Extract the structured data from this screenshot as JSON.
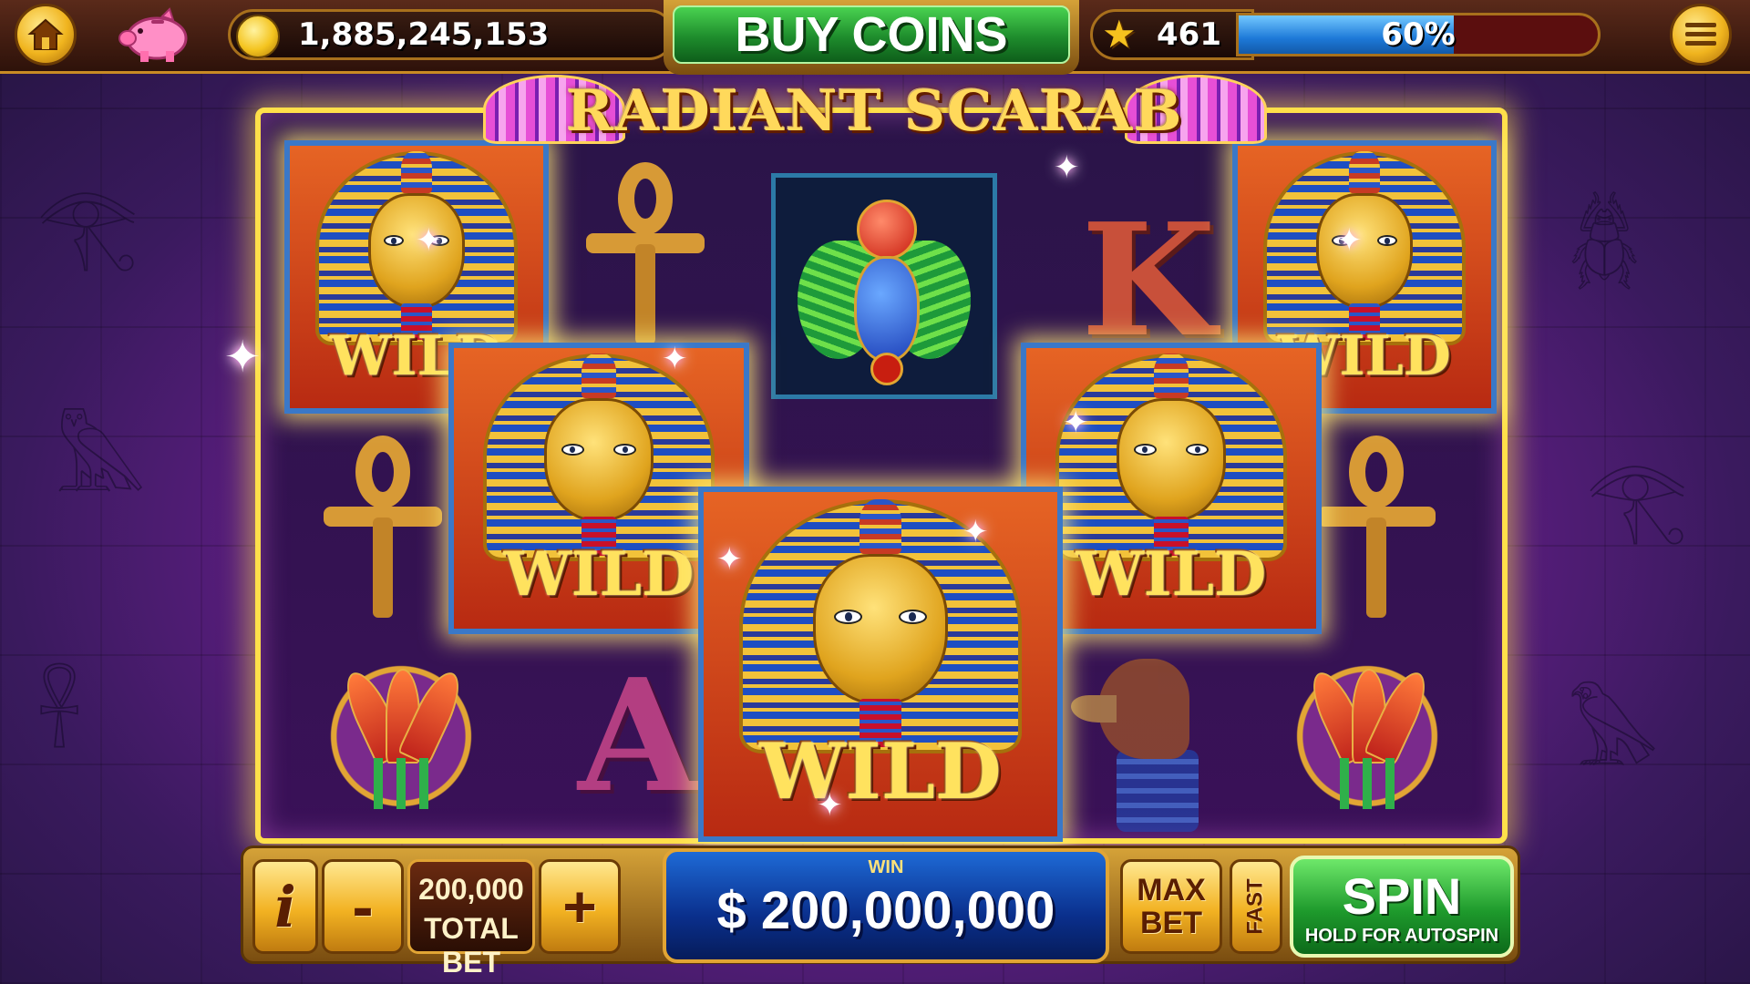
{
  "game": {
    "title": "RADIANT SCARAB"
  },
  "topbar": {
    "home_icon": "home-icon",
    "piggy_bank_icon": "piggy-bank-icon",
    "coin_balance": "1,885,245,153",
    "buy_coins_label": "BUY COINS",
    "level": "461",
    "level_progress_fraction": 0.6,
    "level_progress_label": "60%",
    "menu_icon": "menu-icon"
  },
  "reels": {
    "wild_label": "WILD",
    "symbols": {
      "king_letter": "K",
      "ace_letter": "A"
    }
  },
  "bottombar": {
    "info_label": "i",
    "decrease_bet_label": "-",
    "total_bet_value": "200,000",
    "total_bet_label": "TOTAL BET",
    "increase_bet_label": "+",
    "win_label": "WIN",
    "win_amount": "$ 200,000,000",
    "max_bet_line1": "MAX",
    "max_bet_line2": "BET",
    "fast_label": "FAST",
    "spin_label": "SPIN",
    "spin_sublabel": "HOLD FOR AUTOSPIN"
  },
  "colors": {
    "background": "#6a1f8f",
    "reel_frame": "#ffe04a",
    "buy_coins_green": "#1e8c2c",
    "win_blue": "#0a2f8c",
    "gold": "#f2b222"
  }
}
